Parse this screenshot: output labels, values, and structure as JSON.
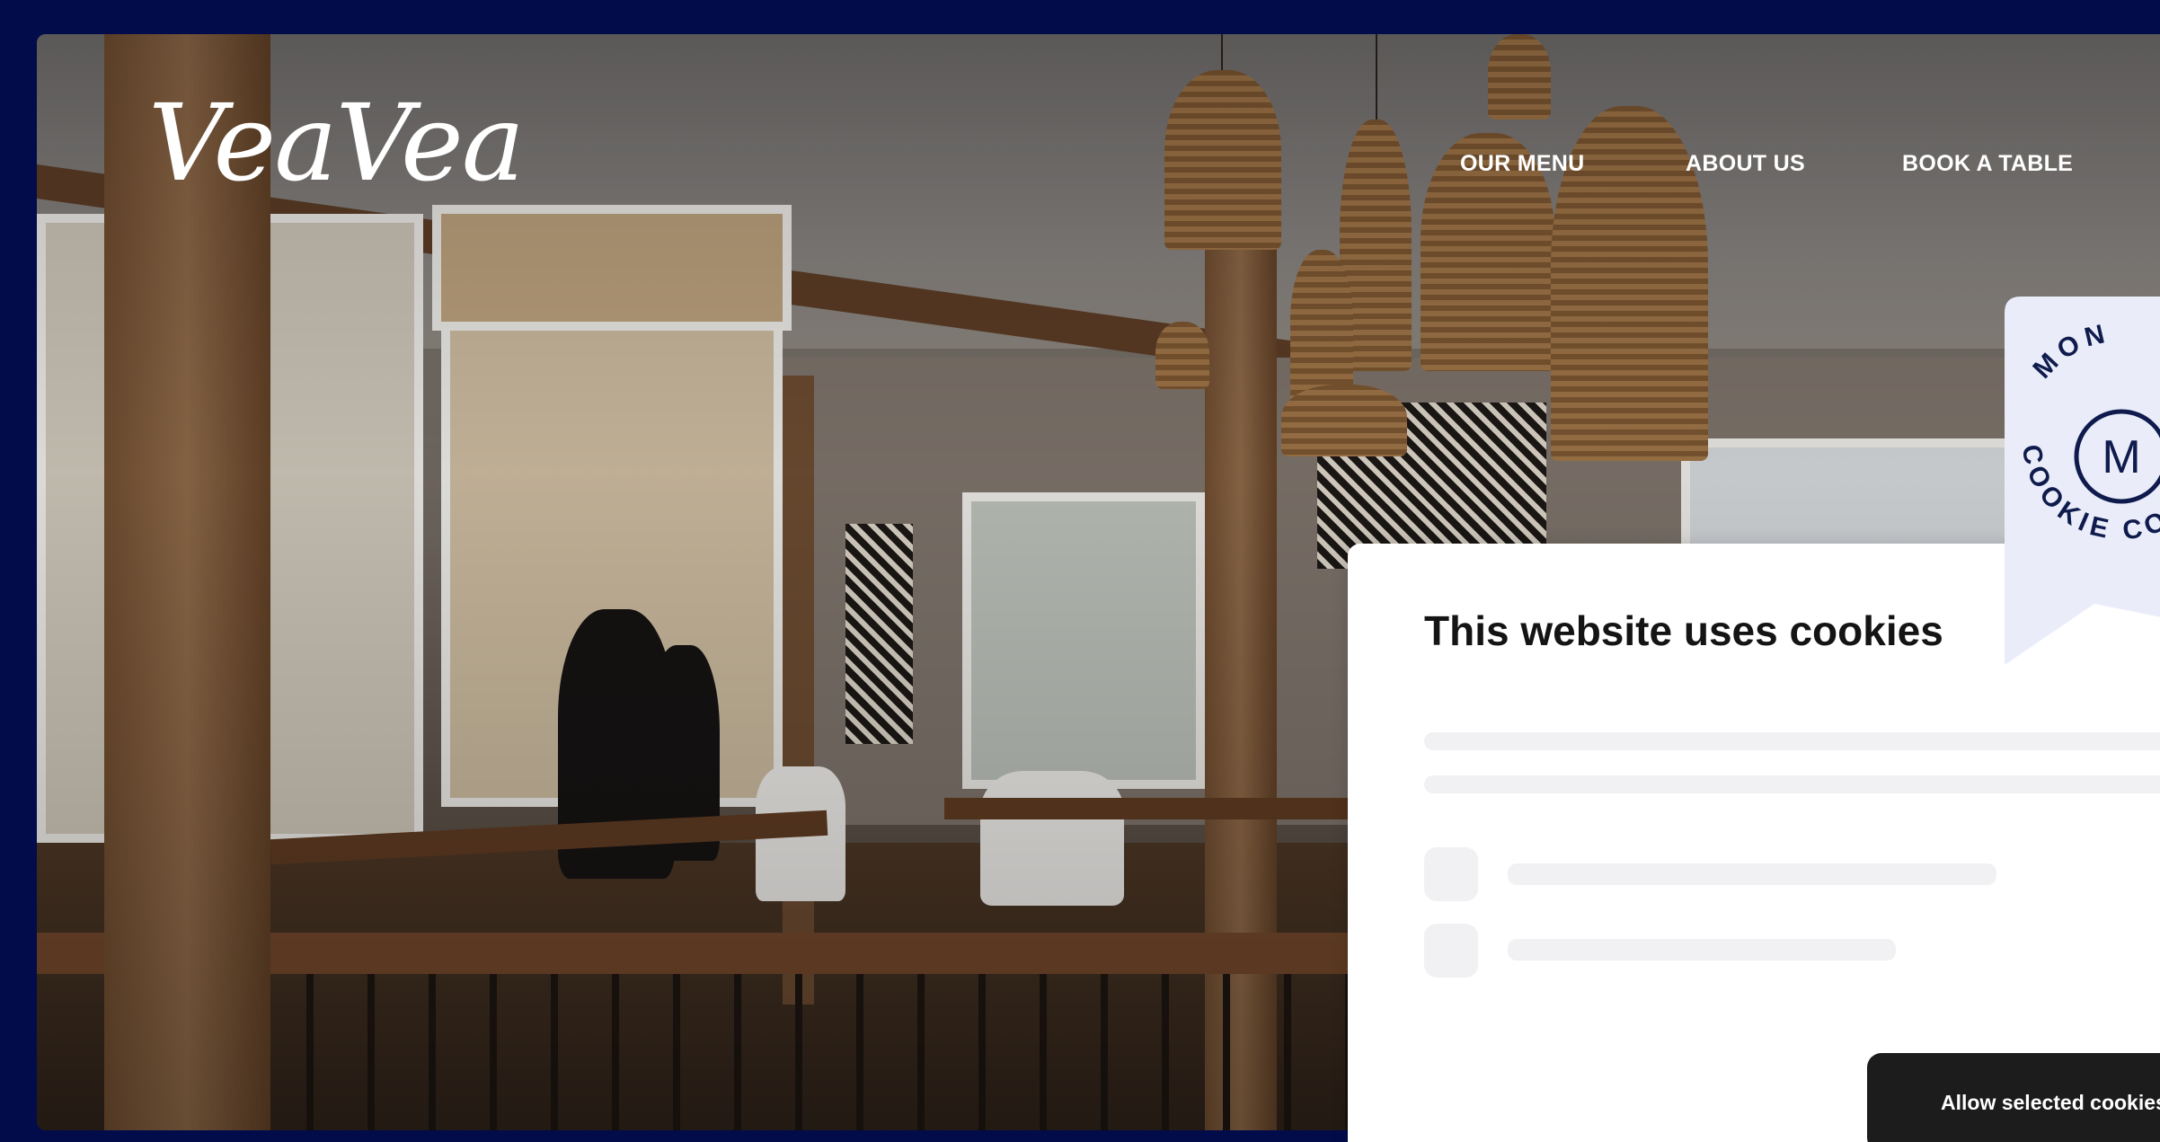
{
  "header": {
    "logo_text": "VeaVea",
    "nav": [
      {
        "label": "OUR MENU"
      },
      {
        "label": "ABOUT US"
      },
      {
        "label": "BOOK A TABLE"
      }
    ]
  },
  "cookie_dialog": {
    "title": "This website uses cookies",
    "allow_button_label": "Allow selected cookies"
  },
  "badge": {
    "top_text": "MON",
    "bottom_text": "COOKIE CO",
    "monogram": "M",
    "color": "#0f1b4d",
    "background": "#eaedf9"
  },
  "colors": {
    "page_background": "#020c4a",
    "button_background": "#1c1c1c",
    "skeleton": "#f1f1f4"
  }
}
